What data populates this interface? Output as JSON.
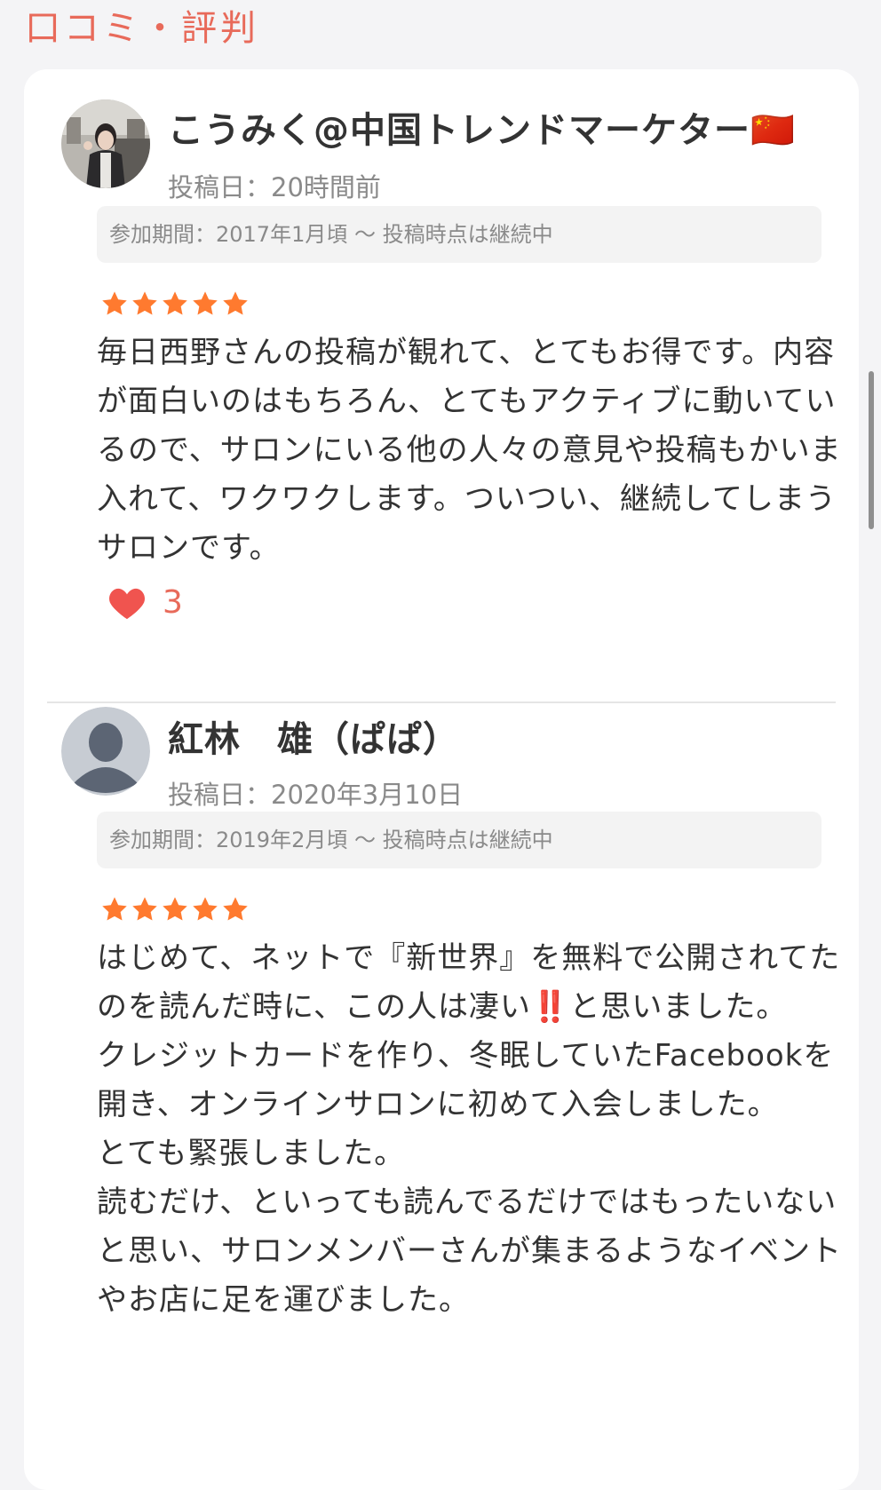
{
  "section": {
    "title": "口コミ・評判"
  },
  "colors": {
    "accent": "#e86a5a",
    "star": "#ff7a2f",
    "heart": "#f0544f"
  },
  "reviews": [
    {
      "author": "こうみく@中国トレンドマーケター🇨🇳",
      "posted": "投稿日：20時間前",
      "period": "参加期間：2017年1月頃 〜 投稿時点は継続中",
      "rating": 5,
      "body": "毎日西野さんの投稿が観れて、とてもお得です。内容が面白いのはもちろん、とてもアクティブに動いているので、サロンにいる他の人々の意見や投稿もかいま入れて、ワクワクします。ついつい、継続してしまうサロンです。",
      "likes": "3",
      "avatar_icon": "user-photo-avatar"
    },
    {
      "author": "紅林　雄（ぱぱ）",
      "posted": "投稿日：2020年3月10日",
      "period": "参加期間：2019年2月頃 〜 投稿時点は継続中",
      "rating": 5,
      "body": "はじめて、ネットで『新世界』を無料で公開されてたのを読んだ時に、この人は凄い‼️と思いました。\nクレジットカードを作り、冬眠していたFacebookを開き、オンラインサロンに初めて入会しました。\nとても緊張しました。\n読むだけ、といっても読んでるだけではもったいないと思い、サロンメンバーさんが集まるようなイベントやお店に足を運びました。",
      "avatar_icon": "default-user-avatar"
    }
  ]
}
